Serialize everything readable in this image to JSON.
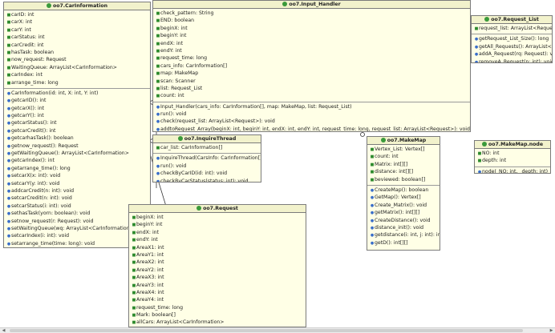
{
  "classes": {
    "carinfo": {
      "title": "oo7.CarInformation",
      "attributes": [
        "carID: int",
        "carX: int",
        "carY: int",
        "carStatus: int",
        "carCredit: int",
        "hasTask: boolean",
        "now_request: Request",
        "WaitingQueue: ArrayList<CarInformation>",
        "carIndex: int",
        "arrange_time: long"
      ],
      "methods": [
        "CarInformation(id: int, X: int, Y: int)",
        "getcarID(): int",
        "getcarX(): int",
        "getcarY(): int",
        "getcarStatus(): int",
        "getcarCredit(): int",
        "getcarhasTask(): boolean",
        "getnow_request(): Request",
        "getWaitingQueue(): ArrayList<CarInformation>",
        "getcarIndex(): int",
        "getarrange_time(): long",
        "setcarX(x: int): void",
        "setcarY(y: int): void",
        "addcarCredit(n: int): void",
        "setcarCredit(n: int): void",
        "setcarStatus(i: int): void",
        "sethasTask(yorn: boolean): void",
        "setnow_request(r: Request): void",
        "setWaitingQueue(wq: ArrayList<CarInformation>): void",
        "setcarIndex(i: int): void",
        "setarrange_time(time: long): void"
      ]
    },
    "inputhandler": {
      "title": "oo7.Input_Handler",
      "attributes": [
        "check_pattern: String",
        "END: boolean",
        "beginX: int",
        "beginY: int",
        "endX: int",
        "endY: int",
        "request_time: long",
        "cars_info: CarInformation[]",
        "map: MakeMap",
        "scan: Scanner",
        "list: Request_List",
        "count: int"
      ],
      "methods": [
        "Input_Handler(cars_info: CarInformation[], map: MakeMap, list: Request_List)",
        "run(): void",
        "check(request_list: ArrayList<Request>): void",
        "addtoRequest_Array(beginX: int, beginY: int, endX: int, endY: int, request_time: long, request_list: ArrayList<Request>): void"
      ]
    },
    "requestlist": {
      "title": "oo7.Request_List",
      "attributes": [
        "request_list: ArrayList<Request>"
      ],
      "methods": [
        "getRequest_List_Size(): long",
        "getAll_Requests(): ArrayList<Request>",
        "addA_Request(rq: Request): void",
        "removeA_Request(n: int): void"
      ]
    },
    "inquire": {
      "title": "oo7.InquireThread",
      "attributes": [
        "car_list: CarInformation[]"
      ],
      "methods": [
        "InquireThread(CarsInfo: CarInformation[])",
        "run(): void",
        "checkByCarID(id: int): void",
        "checkByCarStatus(status: int): void"
      ]
    },
    "makemap": {
      "title": "oo7.MakeMap",
      "attributes": [
        "Vertex_List: Vertex[]",
        "count: int",
        "Matrix: int[][]",
        "distance: int[][]",
        "beviewed: boolean[]"
      ],
      "methods": [
        "CreateMap(): boolean",
        "GetMap(): Vertex[]",
        "Create_Matrix(): void",
        "getMatrix(): int[][]",
        "CreateDistance(): void",
        "distance_init(): void",
        "getdistance(i: int, j: int): int",
        "getD(): int[][]"
      ]
    },
    "makemapnode": {
      "title": "oo7.MakeMap.node",
      "attributes": [
        "NO: int",
        "depth: int"
      ],
      "methods": [
        "node(_NO: int, _depth: int)"
      ]
    },
    "request": {
      "title": "oo7.Request",
      "attributes": [
        "beginX: int",
        "beginY: int",
        "endX: int",
        "endY: int",
        "AreaX1: int",
        "AreaY1: int",
        "AreaX2: int",
        "AreaY2: int",
        "AreaX3: int",
        "AreaY3: int",
        "AreaX4: int",
        "AreaY4: int",
        "request_time: long",
        "Mark: boolean[]",
        "allCars: ArrayList<CarInformation>"
      ],
      "methods": []
    }
  },
  "colors": {
    "box_fill": "#ffffe6",
    "header_fill": "#f2f2cc",
    "border": "#7b7b7b",
    "attr_marker": "#2d8a2d",
    "method_marker": "#3a6ec9"
  }
}
